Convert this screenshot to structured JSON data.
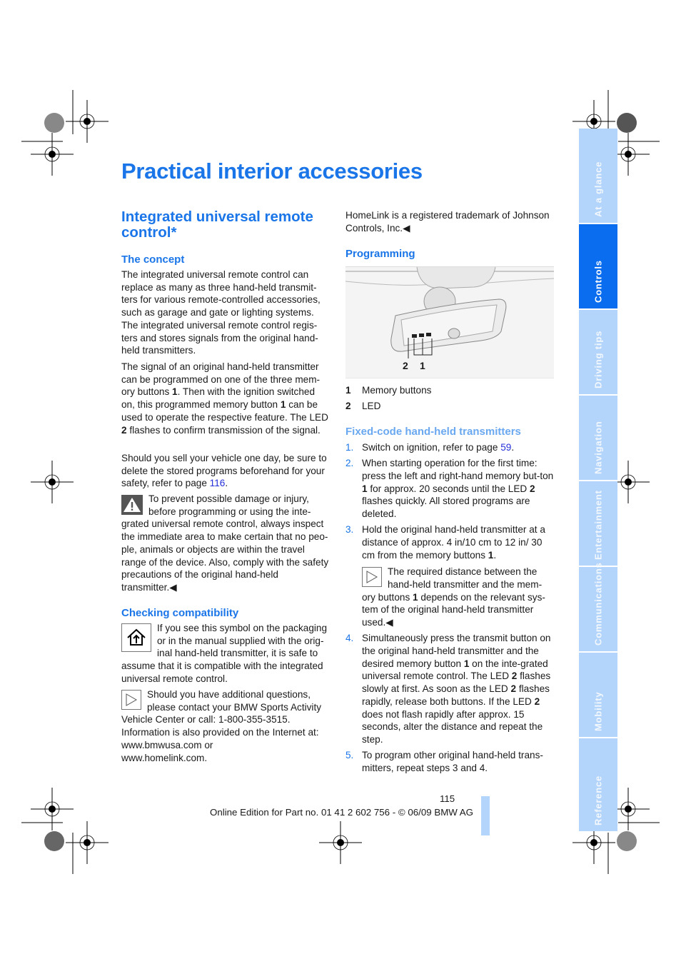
{
  "page": {
    "title": "Practical interior accessories",
    "page_number": "115",
    "footer": "Online Edition for Part no. 01 41 2 602 756 - © 06/09 BMW AG"
  },
  "sidebar": {
    "tabs": [
      {
        "label": "At a glance",
        "active": false
      },
      {
        "label": "Controls",
        "active": true
      },
      {
        "label": "Driving tips",
        "active": false
      },
      {
        "label": "Navigation",
        "active": false
      },
      {
        "label": "Entertainment",
        "active": false
      },
      {
        "label": "Communications",
        "active": false
      },
      {
        "label": "Mobility",
        "active": false
      },
      {
        "label": "Reference",
        "active": false
      }
    ]
  },
  "left": {
    "section_title": "Integrated universal remote control*",
    "concept": {
      "heading": "The concept",
      "p1": "The integrated universal remote control can replace as many as three hand-held transmit-ters for various remote-controlled accessories, such as garage and gate or lighting systems. The integrated universal remote control regis-ters and stores signals from the original hand-held transmitters.",
      "p2_a": "The signal of an original hand-held transmitter can be programmed on one of the three mem-ory buttons ",
      "p2_b": "1",
      "p2_c": ". Then with the ignition switched on, this programmed memory button ",
      "p2_d": "1",
      "p2_e": " can be used to operate the respective feature. The LED ",
      "p2_f": "2",
      "p2_g": " flashes to confirm transmission of the signal.",
      "p3_a": "Should you sell your vehicle one day, be sure to delete the stored programs beforehand for your safety, refer to page ",
      "p3_link": "116",
      "p3_b": "."
    },
    "warning": {
      "icon": "warning-triangle-icon",
      "text": "To prevent possible damage or injury, before programming or using the inte-grated universal remote control, always inspect the immediate area to make certain that no peo-ple, animals or objects are within the travel range of the device. Also, comply with the safety precautions of the original hand-held transmitter.",
      "end_mark": "◀"
    },
    "compat": {
      "heading": "Checking compatibility",
      "icon": "homelink-house-icon",
      "text": "If you see this symbol on the packaging or in the manual supplied with the orig-inal hand-held transmitter, it is safe to assume that it is compatible with the integrated universal remote control."
    },
    "note": {
      "icon": "note-arrow-icon",
      "text": "Should you have additional questions, please contact your BMW Sports Activity Vehicle Center or call: 1-800-355-3515. Information is also provided on the Internet at:",
      "url1": "www.bmwusa.com or",
      "url2": "www.homelink.com."
    }
  },
  "right": {
    "trademark": "HomeLink is a registered trademark of Johnson Controls, Inc.",
    "end_mark": "◀",
    "programming_heading": "Programming",
    "figure": {
      "callout_1": "1",
      "callout_2": "2",
      "legend": [
        {
          "key": "1",
          "label": "Memory buttons"
        },
        {
          "key": "2",
          "label": "LED"
        }
      ]
    },
    "fixed_heading": "Fixed-code hand-held transmitters",
    "steps": [
      {
        "num": "1.",
        "a": "Switch on ignition, refer to page ",
        "link": "59",
        "b": "."
      },
      {
        "num": "2.",
        "a": "When starting operation for the first time: press the left and right-hand memory but-ton ",
        "b1": "1",
        "b": " for approx. 20 seconds until the LED ",
        "b2": "2",
        "c": " flashes quickly. All stored programs are deleted."
      },
      {
        "num": "3.",
        "a": "Hold the original hand-held transmitter at a distance of approx. 4 in/10 cm to 12 in/ 30 cm from the memory buttons ",
        "b1": "1",
        "b": "."
      },
      {
        "num": "4.",
        "a": "Simultaneously press the transmit button on the original hand-held transmitter and the desired memory button ",
        "b1": "1",
        "b": " on the inte-grated universal remote control. The LED ",
        "b2": "2",
        "c": " flashes slowly at first. As soon as the LED ",
        "b3": "2",
        "d": " flashes rapidly, release both buttons. If the LED ",
        "b4": "2",
        "e": " does not flash rapidly after approx. 15 seconds, alter the distance and repeat the step."
      },
      {
        "num": "5.",
        "a": "To program other original hand-held trans-mitters, repeat steps 3 and 4."
      }
    ],
    "step_note": {
      "icon": "note-arrow-icon",
      "a": "The required distance between the hand-held transmitter and the mem-ory buttons ",
      "b1": "1",
      "b": " depends on the relevant sys-tem of the original hand-held transmitter used.",
      "end_mark": "◀"
    }
  }
}
